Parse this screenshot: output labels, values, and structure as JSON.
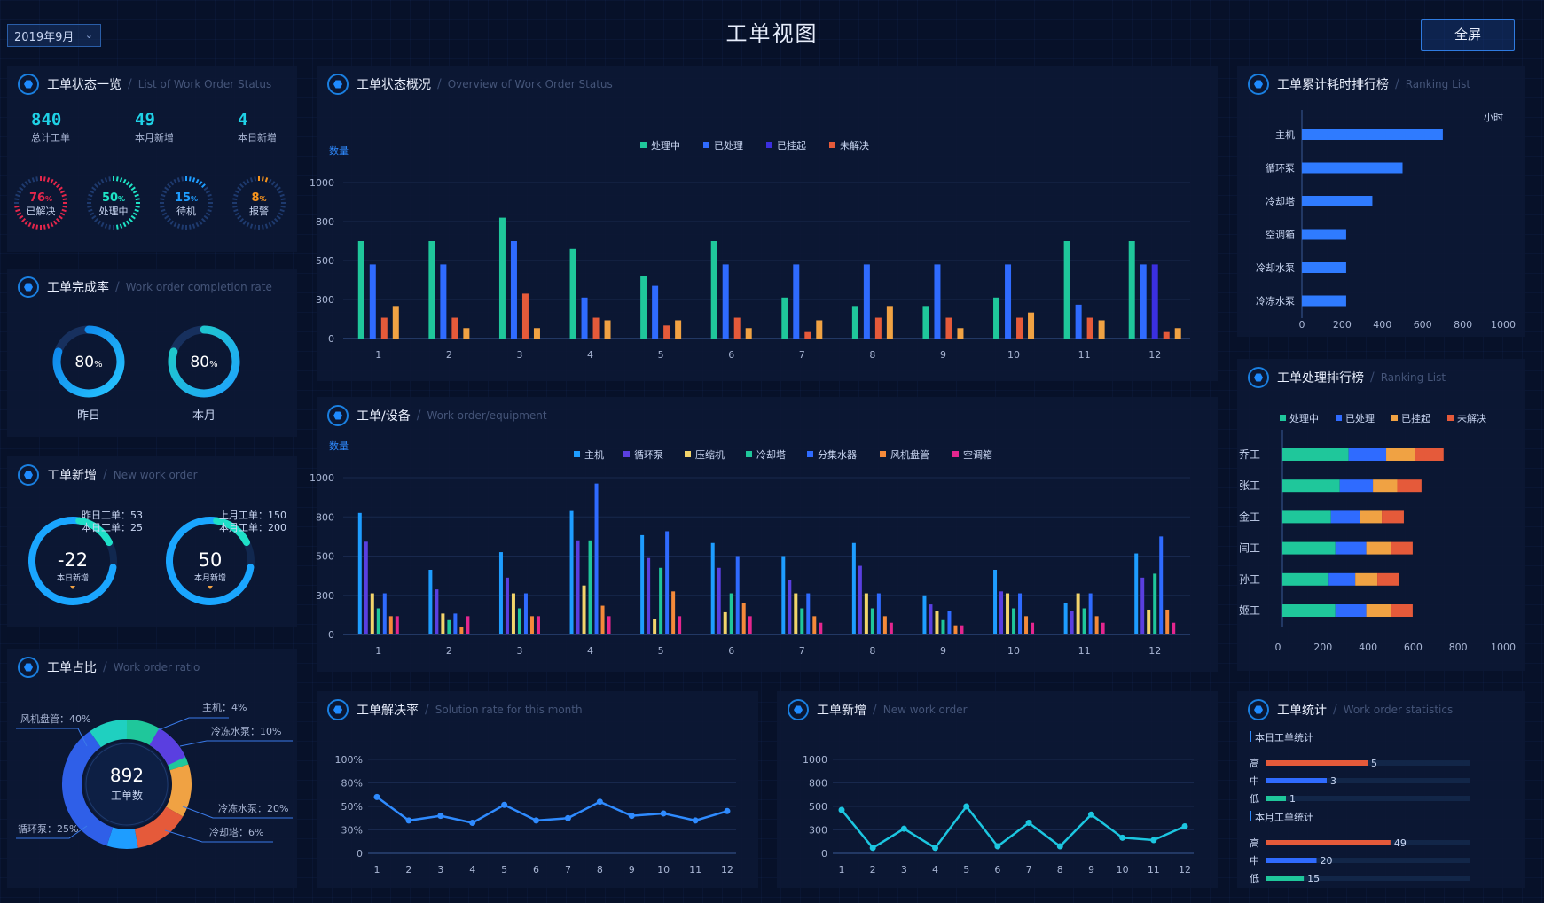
{
  "header": {
    "title": "工单视图",
    "date_select": "2019年9月",
    "fullscreen": "全屏"
  },
  "status_panel": {
    "title": "工单状态一览",
    "subtitle": "List of Work Order Status",
    "stats": [
      {
        "value": "840",
        "label": "总计工单"
      },
      {
        "value": "49",
        "label": "本月新增"
      },
      {
        "value": "4",
        "label": "本日新增"
      }
    ],
    "gauges": [
      {
        "pct": 76,
        "unit": "%",
        "label": "已解决",
        "color": "#e4264b"
      },
      {
        "pct": 50,
        "unit": "%",
        "label": "处理中",
        "color": "#1ee3c5"
      },
      {
        "pct": 15,
        "unit": "%",
        "label": "待机",
        "color": "#1e9dff"
      },
      {
        "pct": 8,
        "unit": "%",
        "label": "报警",
        "color": "#f7941d"
      }
    ]
  },
  "completion_panel": {
    "title": "工单完成率",
    "subtitle": "Work order completion rate",
    "rings": [
      {
        "value": "80",
        "unit": "%",
        "label": "昨日",
        "pct": 80
      },
      {
        "value": "80",
        "unit": "%",
        "label": "本月",
        "pct": 80
      }
    ]
  },
  "new_panel": {
    "title": "工单新增",
    "subtitle": "New work order",
    "items": [
      {
        "value": "-22",
        "label": "本日新增",
        "line1": "昨日工单：53",
        "line2": "本日工单：25"
      },
      {
        "value": "50",
        "label": "本月新增",
        "line1": "上月工单：150",
        "line2": "本月工单：200"
      }
    ]
  },
  "ratio_panel": {
    "title": "工单占比",
    "subtitle": "Work order ratio",
    "center_value": "892",
    "center_label": "工单数",
    "labels": {
      "a": "主机：4%",
      "b": "冷冻水泵：10%",
      "c": "冷冻水泵：20%",
      "d": "冷却塔：6%",
      "e": "循环泵：25%",
      "f": "风机盘管：40%"
    }
  },
  "overview_panel": {
    "title": "工单状态概况",
    "subtitle": "Overview of Work Order Status"
  },
  "equipment_panel": {
    "title": "工单/设备",
    "subtitle": "Work order/equipment"
  },
  "solution_panel": {
    "title": "工单解决率",
    "subtitle": "Solution rate for this month"
  },
  "new2_panel": {
    "title": "工单新增",
    "subtitle": "New work order"
  },
  "rank_time_panel": {
    "title": "工单累计耗时排行榜",
    "subtitle": "Ranking List"
  },
  "rank_proc_panel": {
    "title": "工单处理排行榜",
    "subtitle": "Ranking List"
  },
  "stats_panel": {
    "title": "工单统计",
    "subtitle": "Work order statistics",
    "today_title": "本日工单统计",
    "month_title": "本月工单统计",
    "today": [
      {
        "label": "高",
        "value": 5,
        "color": "#e55a3a"
      },
      {
        "label": "中",
        "value": 3,
        "color": "#2f6bff"
      },
      {
        "label": "低",
        "value": 1,
        "color": "#1fc79b"
      }
    ],
    "month": [
      {
        "label": "高",
        "value": 49,
        "color": "#e55a3a"
      },
      {
        "label": "中",
        "value": 20,
        "color": "#2f6bff"
      },
      {
        "label": "低",
        "value": 15,
        "color": "#1fc79b"
      }
    ]
  },
  "chart_data": [
    {
      "id": "overview",
      "type": "bar",
      "ylabel": "数量",
      "categories": [
        "1",
        "2",
        "3",
        "4",
        "5",
        "6",
        "7",
        "8",
        "9",
        "10",
        "11",
        "12"
      ],
      "yticks": [
        "0",
        "300",
        "500",
        "800",
        "1000"
      ],
      "ylim": [
        0,
        1000
      ],
      "legend_position": "top-center",
      "series": [
        {
          "name": "处理中",
          "color": "#1fc79b",
          "values": [
            650,
            650,
            820,
            590,
            420,
            650,
            310,
            250,
            250,
            310,
            650,
            650
          ]
        },
        {
          "name": "已处理",
          "color": "#2f6bff",
          "values": [
            480,
            480,
            650,
            310,
            370,
            480,
            480,
            480,
            480,
            480,
            260,
            480
          ]
        },
        {
          "name": "已挂起",
          "color": "#3b2fe0",
          "values": [
            null,
            null,
            null,
            null,
            null,
            null,
            null,
            null,
            null,
            null,
            null,
            480
          ]
        },
        {
          "name": "未解决",
          "color": "#e55a3a",
          "values": [
            160,
            160,
            330,
            160,
            100,
            160,
            50,
            160,
            160,
            160,
            160,
            50
          ]
        },
        {
          "name": "",
          "color": "#f0a243",
          "values": [
            250,
            80,
            80,
            140,
            140,
            80,
            140,
            250,
            80,
            200,
            140,
            80
          ]
        }
      ]
    },
    {
      "id": "equipment",
      "type": "bar",
      "ylabel": "数量",
      "categories": [
        "1",
        "2",
        "3",
        "4",
        "5",
        "6",
        "7",
        "8",
        "9",
        "10",
        "11",
        "12"
      ],
      "yticks": [
        "0",
        "300",
        "500",
        "800",
        "1000"
      ],
      "ylim": [
        0,
        1000
      ],
      "legend_position": "top-center",
      "series": [
        {
          "name": "主机",
          "color": "#1e9dff",
          "values": [
            820,
            430,
            530,
            830,
            660,
            600,
            500,
            600,
            300,
            430,
            240,
            520
          ]
        },
        {
          "name": "循环泵",
          "color": "#5a3fe0",
          "values": [
            610,
            330,
            390,
            620,
            490,
            440,
            380,
            450,
            230,
            320,
            180,
            390
          ]
        },
        {
          "name": "压缩机",
          "color": "#f2d46b",
          "values": [
            310,
            160,
            310,
            350,
            120,
            170,
            310,
            310,
            180,
            310,
            310,
            190
          ]
        },
        {
          "name": "冷却塔",
          "color": "#1fc79b",
          "values": [
            200,
            110,
            200,
            620,
            440,
            310,
            200,
            200,
            110,
            200,
            200,
            410
          ]
        },
        {
          "name": "分集水器",
          "color": "#2f6bff",
          "values": [
            310,
            160,
            310,
            970,
            690,
            500,
            310,
            310,
            180,
            310,
            310,
            650
          ]
        },
        {
          "name": "风机盘管",
          "color": "#f58a3a",
          "values": [
            140,
            60,
            140,
            220,
            320,
            240,
            140,
            140,
            70,
            140,
            140,
            190
          ]
        },
        {
          "name": "空调箱",
          "color": "#e4268f",
          "values": [
            140,
            140,
            140,
            140,
            140,
            140,
            90,
            90,
            70,
            90,
            90,
            90
          ]
        }
      ]
    },
    {
      "id": "solution",
      "type": "line",
      "categories": [
        "1",
        "2",
        "3",
        "4",
        "5",
        "6",
        "7",
        "8",
        "9",
        "10",
        "11",
        "12"
      ],
      "yticks": [
        "0",
        "30%",
        "50%",
        "80%",
        "100%"
      ],
      "color": "#2f8bff",
      "values": [
        62,
        38,
        42,
        36,
        52,
        38,
        40,
        56,
        42,
        44,
        38,
        46
      ]
    },
    {
      "id": "new_orders",
      "type": "line",
      "categories": [
        "1",
        "2",
        "3",
        "4",
        "5",
        "6",
        "7",
        "8",
        "9",
        "10",
        "11",
        "12"
      ],
      "yticks": [
        "0",
        "300",
        "500",
        "800",
        "1000"
      ],
      "color": "#1cc6e0",
      "values": [
        470,
        70,
        310,
        70,
        500,
        90,
        360,
        90,
        430,
        200,
        170,
        330
      ]
    },
    {
      "id": "rank_time",
      "type": "bar",
      "unit": "小时",
      "orientation": "horizontal",
      "categories": [
        "主机",
        "循环泵",
        "冷却塔",
        "空调箱",
        "冷却水泵",
        "冷冻水泵"
      ],
      "values": [
        700,
        500,
        350,
        220,
        220,
        220
      ],
      "xticks": [
        "0",
        "200",
        "400",
        "600",
        "800",
        "1000"
      ],
      "xlim": [
        0,
        1000
      ],
      "color": "#2f7bff"
    },
    {
      "id": "rank_process",
      "type": "bar",
      "orientation": "horizontal",
      "stacked": true,
      "categories": [
        "乔工",
        "张工",
        "金工",
        "闫工",
        "孙工",
        "姬工"
      ],
      "xticks": [
        "0",
        "200",
        "400",
        "600",
        "800",
        "1000"
      ],
      "xlim": [
        0,
        1000
      ],
      "series": [
        {
          "name": "处理中",
          "color": "#1fc79b",
          "values": [
            300,
            260,
            220,
            240,
            210,
            240
          ]
        },
        {
          "name": "已处理",
          "color": "#2f6bff",
          "values": [
            170,
            150,
            130,
            140,
            120,
            140
          ]
        },
        {
          "name": "已挂起",
          "color": "#f0a243",
          "values": [
            130,
            110,
            100,
            110,
            100,
            110
          ]
        },
        {
          "name": "未解决",
          "color": "#e55a3a",
          "values": [
            130,
            110,
            100,
            100,
            100,
            100
          ]
        }
      ]
    }
  ]
}
